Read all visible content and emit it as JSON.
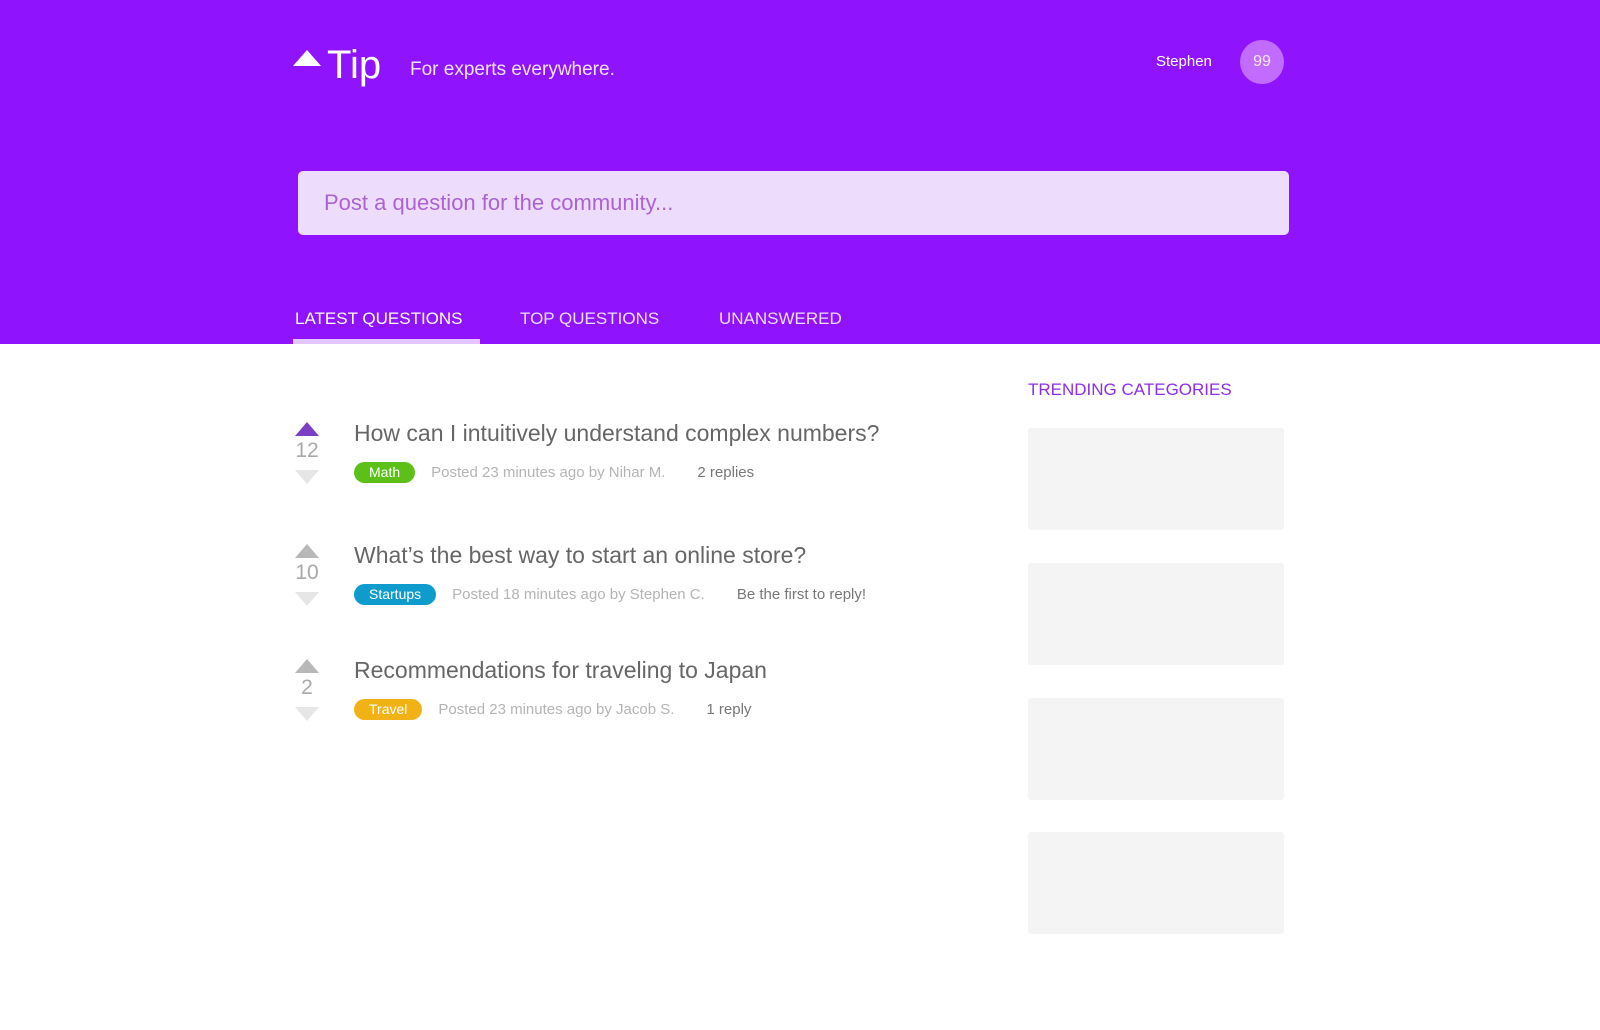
{
  "header": {
    "logo_icon": "triangle-up-icon",
    "brand_name": "Tip",
    "tagline": "For experts everywhere.",
    "user_name": "Stephen",
    "user_points": "99",
    "background_color": "#9013fe"
  },
  "search": {
    "placeholder": "Post a question for the community..."
  },
  "tabs": [
    {
      "label": "LATEST QUESTIONS",
      "active": true
    },
    {
      "label": "TOP QUESTIONS",
      "active": false
    },
    {
      "label": "UNANSWERED",
      "active": false
    }
  ],
  "questions": [
    {
      "votes": "12",
      "upvoted": true,
      "title": "How can I intuitively understand complex numbers?",
      "tag": "Math",
      "tag_color": "#5cc018",
      "posted": "Posted 23 minutes ago by Nihar M.",
      "replies": "2 replies"
    },
    {
      "votes": "10",
      "upvoted": false,
      "title": "What’s the best way to start an online store?",
      "tag": "Startups",
      "tag_color": "#0f9ccd",
      "posted": "Posted 18 minutes ago by Stephen C.",
      "replies": "Be the first to reply!"
    },
    {
      "votes": "2",
      "upvoted": false,
      "title": "Recommendations for traveling to Japan",
      "tag": "Travel",
      "tag_color": "#f1b215",
      "posted": "Posted 23 minutes ago by Jacob S.",
      "replies": "1 reply"
    }
  ],
  "sidebar": {
    "title": "TRENDING CATEGORIES"
  }
}
